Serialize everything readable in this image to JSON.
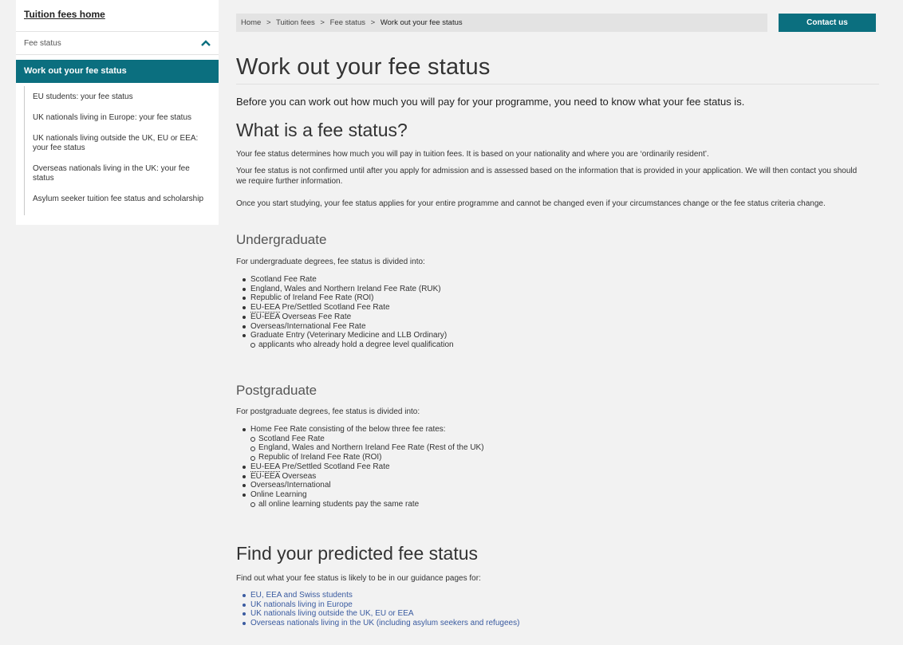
{
  "sidebar": {
    "home": "Tuition fees home",
    "section": "Fee status",
    "active": "Work out your fee status",
    "items": [
      "EU students: your fee status",
      "UK nationals living in Europe: your fee status",
      "UK nationals living outside the UK, EU or EEA: your fee status",
      "Overseas nationals living in the UK: your fee status",
      "Asylum seeker tuition fee status and scholarship"
    ]
  },
  "breadcrumb": {
    "home": "Home",
    "sep": ">",
    "l1": "Tuition fees",
    "l2": "Fee status",
    "current": "Work out your fee status"
  },
  "contact_label": "Contact us",
  "page_title": "Work out your fee status",
  "lead": "Before you can work out how much you will pay for your programme, you need to know what your fee status is.",
  "what": {
    "heading": "What is a fee status?",
    "p1": "Your fee status determines how much you will pay in tuition fees. It is based on your nationality and where you are ‘ordinarily resident’.",
    "p2": "Your fee status is not confirmed until after you apply for admission and is assessed based on the information that is provided in your application. We will then contact you should we require further information.",
    "p3": "Once you start studying, your fee status applies for your entire programme and cannot be changed even if your circumstances change or the fee status criteria change."
  },
  "ug": {
    "heading": "Undergraduate",
    "intro": "For undergraduate degrees, fee status is divided into:",
    "i1": "Scotland Fee Rate",
    "i2": "England, Wales and Northern Ireland Fee Rate (RUK)",
    "i3": "Republic of Ireland Fee Rate (ROI)",
    "i4_abbr": "EU-EEA",
    "i4_rest": " Pre/Settled Scotland Fee Rate",
    "i5": "EU-EEA Overseas Fee Rate",
    "i6": "Overseas/International Fee Rate",
    "i7": "Graduate Entry (Veterinary Medicine and LLB Ordinary)",
    "i7a": "applicants who already hold a degree level qualification"
  },
  "pg": {
    "heading": "Postgraduate",
    "intro": "For postgraduate degrees, fee status is divided into:",
    "i1": "Home Fee Rate consisting of the below three fee rates:",
    "i1a": "Scotland Fee Rate",
    "i1b": "England, Wales and Northern Ireland Fee Rate (Rest of the UK)",
    "i1c": "Republic of Ireland Fee Rate (ROI)",
    "i2_abbr": "EU-EEA",
    "i2_rest": " Pre/Settled Scotland Fee Rate",
    "i3": "EU-EEA Overseas",
    "i4": "Overseas/International",
    "i5": "Online Learning",
    "i5a": "all online learning students pay the same rate"
  },
  "find": {
    "heading": "Find your predicted fee status",
    "intro": "Find out what your fee status is likely to be in our guidance pages for:",
    "links": [
      "EU, EEA and Swiss students",
      "UK nationals living in Europe",
      "UK nationals living outside the UK, EU or EEA",
      "Overseas nationals living in the UK (including asylum seekers and refugees)"
    ]
  },
  "colors": {
    "accent": "#0b6f7f",
    "link": "#3a5ba0"
  }
}
